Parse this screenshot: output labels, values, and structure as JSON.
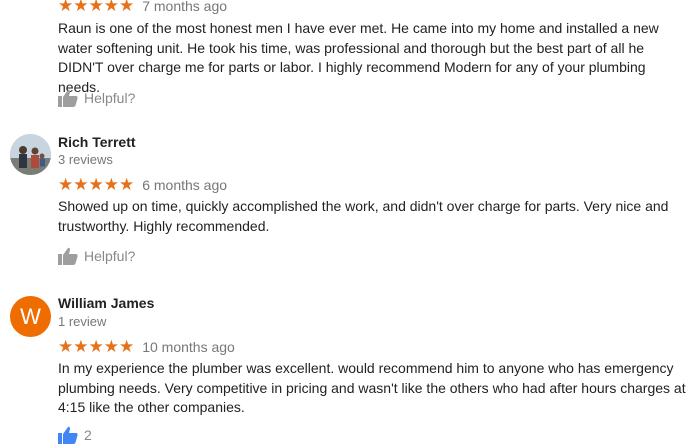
{
  "reviews": [
    {
      "name": "",
      "count": "",
      "stars": "★★★★★",
      "date": "7 months ago",
      "text": "Raun is one of the most honest men I have ever met. He came into my home and installed a new water softening unit.  He took his time, was professional and thorough but the best part of all he DIDN'T over charge me for parts or labor.  I highly recommend Modern for any of your plumbing needs.",
      "helpful": "Helpful?"
    },
    {
      "name": "Rich Terrett",
      "count": "3 reviews",
      "stars": "★★★★★",
      "date": "6 months ago",
      "text": "Showed up on time, quickly accomplished the work, and didn't over charge for parts.  Very nice and trustworthy.  Highly recommended.",
      "helpful": "Helpful?"
    },
    {
      "name": "William James",
      "count": "1 review",
      "avatar_letter": "W",
      "stars": "★★★★★",
      "date": "10 months ago",
      "text": "In my experience the plumber was excellent. would recommend him to anyone who has emergency plumbing needs. Very competitive in pricing and wasn't like the others who had after hours charges at 4:15 like the other companies.",
      "helpful": "2"
    }
  ],
  "colors": {
    "star": "#e7711b",
    "avatar_w": "#ef6c00",
    "thumb_gray": "#9e9e9e",
    "thumb_blue": "#4285f4"
  }
}
